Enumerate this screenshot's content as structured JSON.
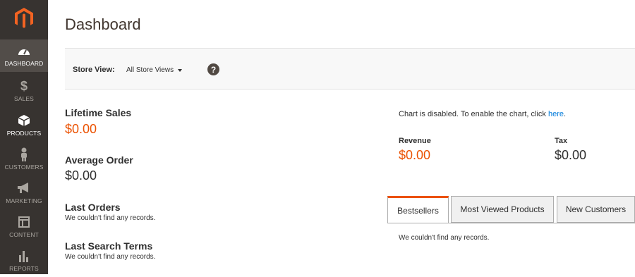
{
  "page": {
    "title": "Dashboard"
  },
  "sidebar": {
    "items": [
      {
        "label": "DASHBOARD",
        "icon": "dashboard-icon"
      },
      {
        "label": "SALES",
        "icon": "dollar-icon"
      },
      {
        "label": "PRODUCTS",
        "icon": "cube-icon"
      },
      {
        "label": "CUSTOMERS",
        "icon": "person-icon"
      },
      {
        "label": "MARKETING",
        "icon": "megaphone-icon"
      },
      {
        "label": "CONTENT",
        "icon": "layout-icon"
      },
      {
        "label": "REPORTS",
        "icon": "bar-chart-icon"
      }
    ]
  },
  "store_switcher": {
    "label": "Store View:",
    "value": "All Store Views",
    "help": "?"
  },
  "stats": {
    "lifetime_sales": {
      "label": "Lifetime Sales",
      "value": "$0.00"
    },
    "average_order": {
      "label": "Average Order",
      "value": "$0.00"
    },
    "last_orders": {
      "label": "Last Orders",
      "empty": "We couldn't find any records."
    },
    "last_search_terms": {
      "label": "Last Search Terms",
      "empty": "We couldn't find any records."
    }
  },
  "chart": {
    "message": "Chart is disabled. To enable the chart, click ",
    "link": "here",
    "suffix": "."
  },
  "totals": {
    "revenue": {
      "label": "Revenue",
      "value": "$0.00"
    },
    "tax": {
      "label": "Tax",
      "value": "$0.00"
    }
  },
  "tabs": {
    "items": [
      {
        "label": "Bestsellers"
      },
      {
        "label": "Most Viewed Products"
      },
      {
        "label": "New Customers"
      }
    ],
    "content": "We couldn't find any records."
  },
  "colors": {
    "accent": "#eb5202",
    "sidebar": "#373330",
    "link": "#007bdb"
  }
}
